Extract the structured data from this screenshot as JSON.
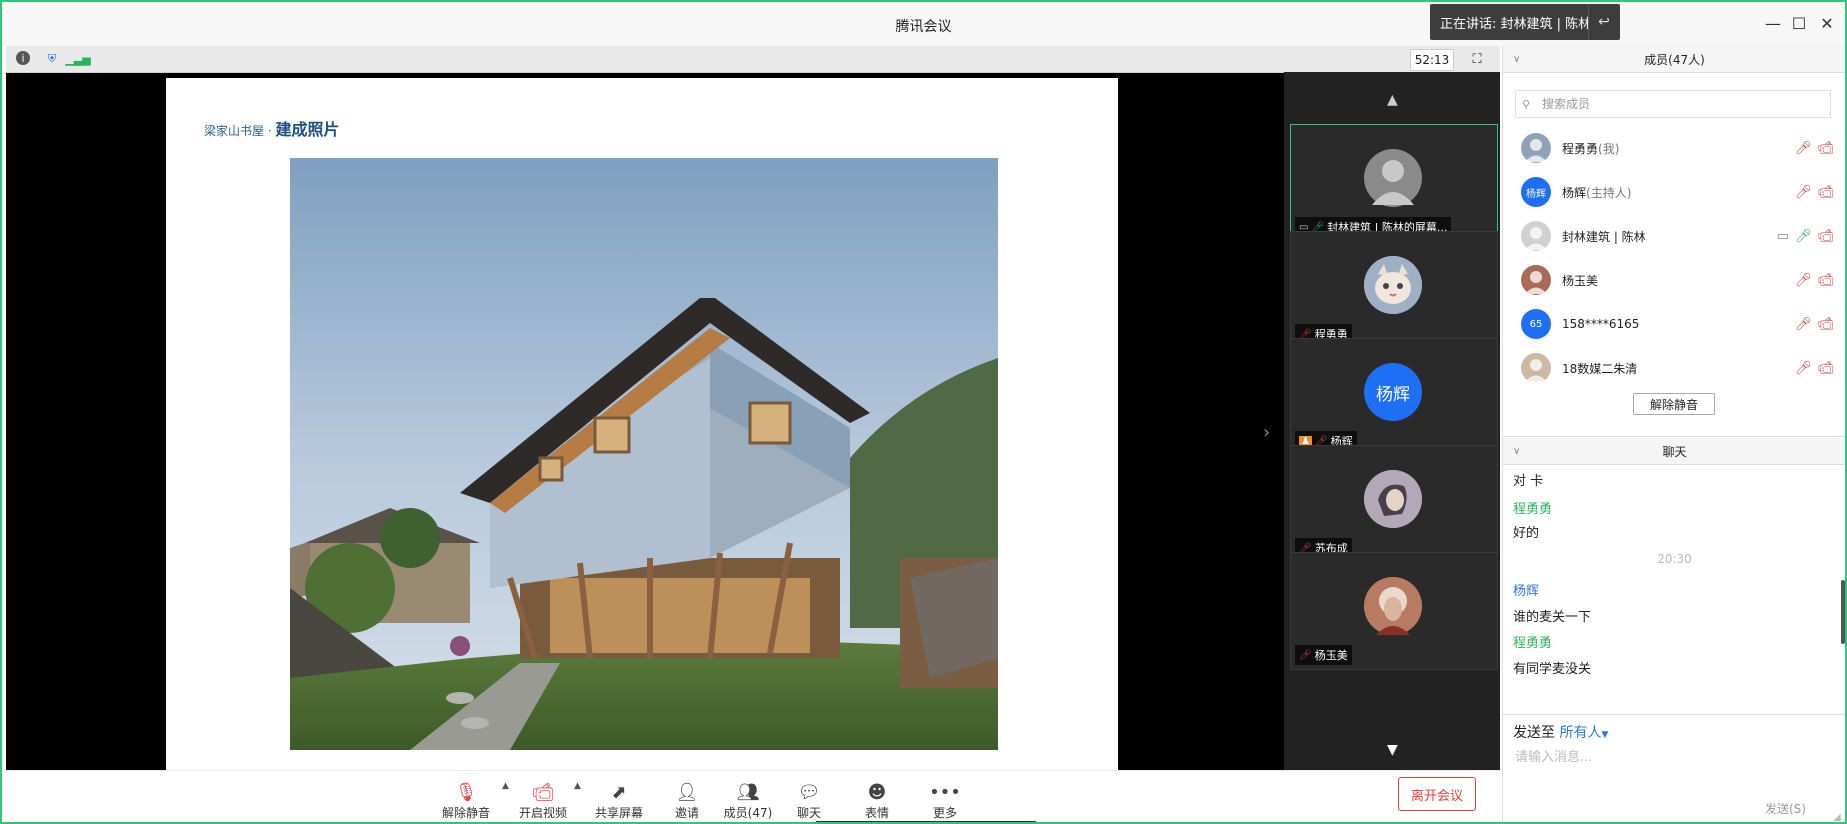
{
  "window": {
    "title": "腾讯会议",
    "speaking": "正在讲话: 封林建筑 | 陈林;",
    "controls": {
      "minimize": "—",
      "maximize": "☐",
      "close": "✕"
    }
  },
  "infobar": {
    "timer": "52:13"
  },
  "slide": {
    "subtitle_small": "梁家山书屋 · ",
    "subtitle_bold": "建成照片"
  },
  "tiles": [
    {
      "name": "封林建筑 | 陈林的屏幕...",
      "avatar": "",
      "color": "#8a8a8a",
      "active": true,
      "mic": "on",
      "sharing": true
    },
    {
      "name": "程勇勇",
      "avatar": "",
      "color": "#8fa2b9",
      "active": false,
      "mic": "off",
      "sharing": false
    },
    {
      "name": "杨辉",
      "avatar": "杨辉",
      "color": "#1e6ff5",
      "active": false,
      "mic": "off",
      "sharing": false,
      "host": true
    },
    {
      "name": "苏布成",
      "avatar": "",
      "color": "#9a8aa0",
      "active": false,
      "mic": "off",
      "sharing": false
    },
    {
      "name": "杨玉美",
      "avatar": "",
      "color": "#a96b55",
      "active": false,
      "mic": "off",
      "sharing": false
    }
  ],
  "toolbar": {
    "unmute": "解除静音",
    "video": "开启视频",
    "share": "共享屏幕",
    "invite": "邀请",
    "members": "成员(47)",
    "chat": "聊天",
    "emoji": "表情",
    "more": "更多",
    "leave": "离开会议"
  },
  "members_panel": {
    "title": "成员(47人)",
    "search_placeholder": "搜索成员",
    "unmute_all": "解除静音",
    "members": [
      {
        "name": "程勇勇",
        "role": "(我)",
        "avatar": "",
        "color": "#8fa2b9",
        "sharing": false,
        "mic": "off"
      },
      {
        "name": "杨辉",
        "role": "(主持人)",
        "avatar": "杨辉",
        "color": "#1e6ff5",
        "sharing": false,
        "mic": "off"
      },
      {
        "name": "封林建筑 | 陈林",
        "role": "",
        "avatar": "",
        "color": "#d0d0d0",
        "sharing": true,
        "mic": "on"
      },
      {
        "name": "杨玉美",
        "role": "",
        "avatar": "",
        "color": "#a96b55",
        "sharing": false,
        "mic": "off"
      },
      {
        "name": "158****6165",
        "role": "",
        "avatar": "65",
        "color": "#1e6ff5",
        "sharing": false,
        "mic": "off"
      },
      {
        "name": "18数媒二朱清",
        "role": "",
        "avatar": "",
        "color": "#c9b9a5",
        "sharing": false,
        "mic": "off"
      }
    ]
  },
  "chat_panel": {
    "title": "聊天",
    "messages": [
      {
        "kind": "text",
        "text": "对 卡"
      },
      {
        "kind": "sender",
        "text": "程勇勇",
        "color": "green"
      },
      {
        "kind": "text",
        "text": "好的"
      },
      {
        "kind": "time",
        "text": "20:30"
      },
      {
        "kind": "sender",
        "text": "杨辉",
        "color": "blue"
      },
      {
        "kind": "text",
        "text": "谁的麦关一下"
      },
      {
        "kind": "sender",
        "text": "程勇勇",
        "color": "green"
      },
      {
        "kind": "text",
        "text": "有同学麦没关"
      }
    ],
    "send_to_label": "发送至",
    "send_to_target": "所有人",
    "input_placeholder": "请输入消息...",
    "send_label": "发送(S)"
  }
}
